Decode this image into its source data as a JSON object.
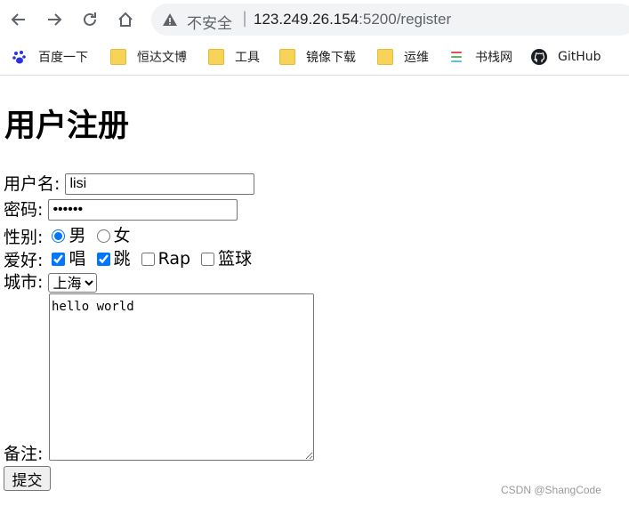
{
  "browser": {
    "address": {
      "security_label": "不安全",
      "separator": "|",
      "host": "123.249.26.154",
      "path": ":5200/register"
    },
    "bookmarks": [
      {
        "label": "百度一下",
        "icon": "baidu-paw-icon"
      },
      {
        "label": "恒达文博",
        "icon": "folder-icon"
      },
      {
        "label": "工具",
        "icon": "folder-icon"
      },
      {
        "label": "镜像下载",
        "icon": "folder-icon"
      },
      {
        "label": "运维",
        "icon": "folder-icon"
      },
      {
        "label": "书栈网",
        "icon": "bookstack-icon"
      },
      {
        "label": "GitHub",
        "icon": "github-icon"
      }
    ]
  },
  "form": {
    "title": "用户注册",
    "username": {
      "label": "用户名:",
      "value": "lisi"
    },
    "password": {
      "label": "密码:",
      "value": "123456"
    },
    "gender": {
      "label": "性别:",
      "options": [
        {
          "label": "男",
          "checked": true
        },
        {
          "label": "女",
          "checked": false
        }
      ]
    },
    "hobbies": {
      "label": "爱好:",
      "options": [
        {
          "label": "唱",
          "checked": true
        },
        {
          "label": "跳",
          "checked": true
        },
        {
          "label": "Rap",
          "checked": false
        },
        {
          "label": "篮球",
          "checked": false
        }
      ]
    },
    "city": {
      "label": "城市:",
      "selected": "上海"
    },
    "remark": {
      "label": "备注:",
      "value": "hello world"
    },
    "submit_label": "提交"
  },
  "watermark": "CSDN @ShangCode",
  "colors": {
    "accent": "#1a73e8",
    "chrome_bg": "#f1f3f4"
  }
}
